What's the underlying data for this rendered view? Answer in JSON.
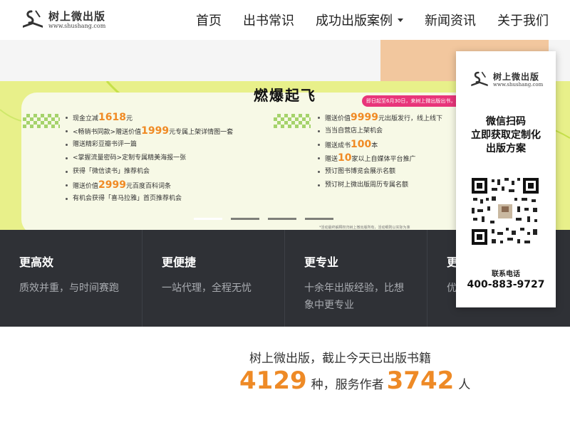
{
  "brand": {
    "name": "树上微出版",
    "url": "www.shushang.com"
  },
  "nav": {
    "items": [
      {
        "label": "首页"
      },
      {
        "label": "出书常识"
      },
      {
        "label": "成功出版案例"
      },
      {
        "label": "新闻资讯"
      },
      {
        "label": "关于我们"
      }
    ]
  },
  "banner": {
    "title": "燃爆起飞",
    "tag": "即日起至6月30日，来树上微出版出书，入驻出版立享",
    "left_benefits": [
      {
        "pre": "现金立减",
        "hl": "1618",
        "post": "元"
      },
      {
        "pre": "<畅销书同款>赠送价值",
        "hl": "1999",
        "post": "元专属上架详情图一套"
      },
      {
        "pre": "赠送精彩豆瓣书评一篇",
        "hl": "",
        "post": ""
      },
      {
        "pre": "<掌握流量密码>定制专属精美海报一张",
        "hl": "",
        "post": ""
      },
      {
        "pre": "获得「微信读书」推荐机会",
        "hl": "",
        "post": ""
      },
      {
        "pre": "赠送价值",
        "hl": "2999",
        "post": "元百度百科词条"
      },
      {
        "pre": "有机会获得「喜马拉雅」首页推荐机会",
        "hl": "",
        "post": ""
      }
    ],
    "right_benefits": [
      {
        "pre": "赠送价值",
        "hl": "9999",
        "post": "元出版发行，线上线下"
      },
      {
        "pre": "当当自营店上架机会",
        "hl": "",
        "post": ""
      },
      {
        "pre": "赠送成书",
        "hl": "100",
        "post": "本"
      },
      {
        "pre": "赠送",
        "hl": "10",
        "post": "家以上自媒体平台推广"
      },
      {
        "pre": "预订图书博览会展示名额",
        "hl": "",
        "post": ""
      },
      {
        "pre": "预订树上微出版周历专属名额",
        "hl": "",
        "post": ""
      }
    ],
    "fineprint": "*活动最终解释权归树上微出版所有，活动细则以实际为准",
    "slides": 4,
    "active_slide": 0
  },
  "features": [
    {
      "title": "更高效",
      "desc": "质效并重，与时间赛跑"
    },
    {
      "title": "更便捷",
      "desc": "一站代理，全程无忧"
    },
    {
      "title": "更专业",
      "desc": "十余年出版经验，比想象中更专业"
    },
    {
      "title": "更",
      "desc": "优为"
    }
  ],
  "stats": {
    "line1": "树上微出版，截止今天已出版书籍",
    "books": "4129",
    "books_unit": "种，服务作者",
    "authors": "3742",
    "authors_unit": "人"
  },
  "qr_panel": {
    "title_lines": [
      "微信扫码",
      "立即获取定制化",
      "出版方案"
    ],
    "contact_label": "联系电话",
    "phone": "400-883-9727"
  },
  "colors": {
    "accent": "#ee8a26",
    "dark_band": "#2f3136",
    "banner_bg": "#e8f08a",
    "tag_pink": "#e8357a"
  },
  "icons": {
    "logo": "book-pen-logo",
    "dropdown": "caret-down-icon",
    "qr": "wechat-qr-code"
  }
}
